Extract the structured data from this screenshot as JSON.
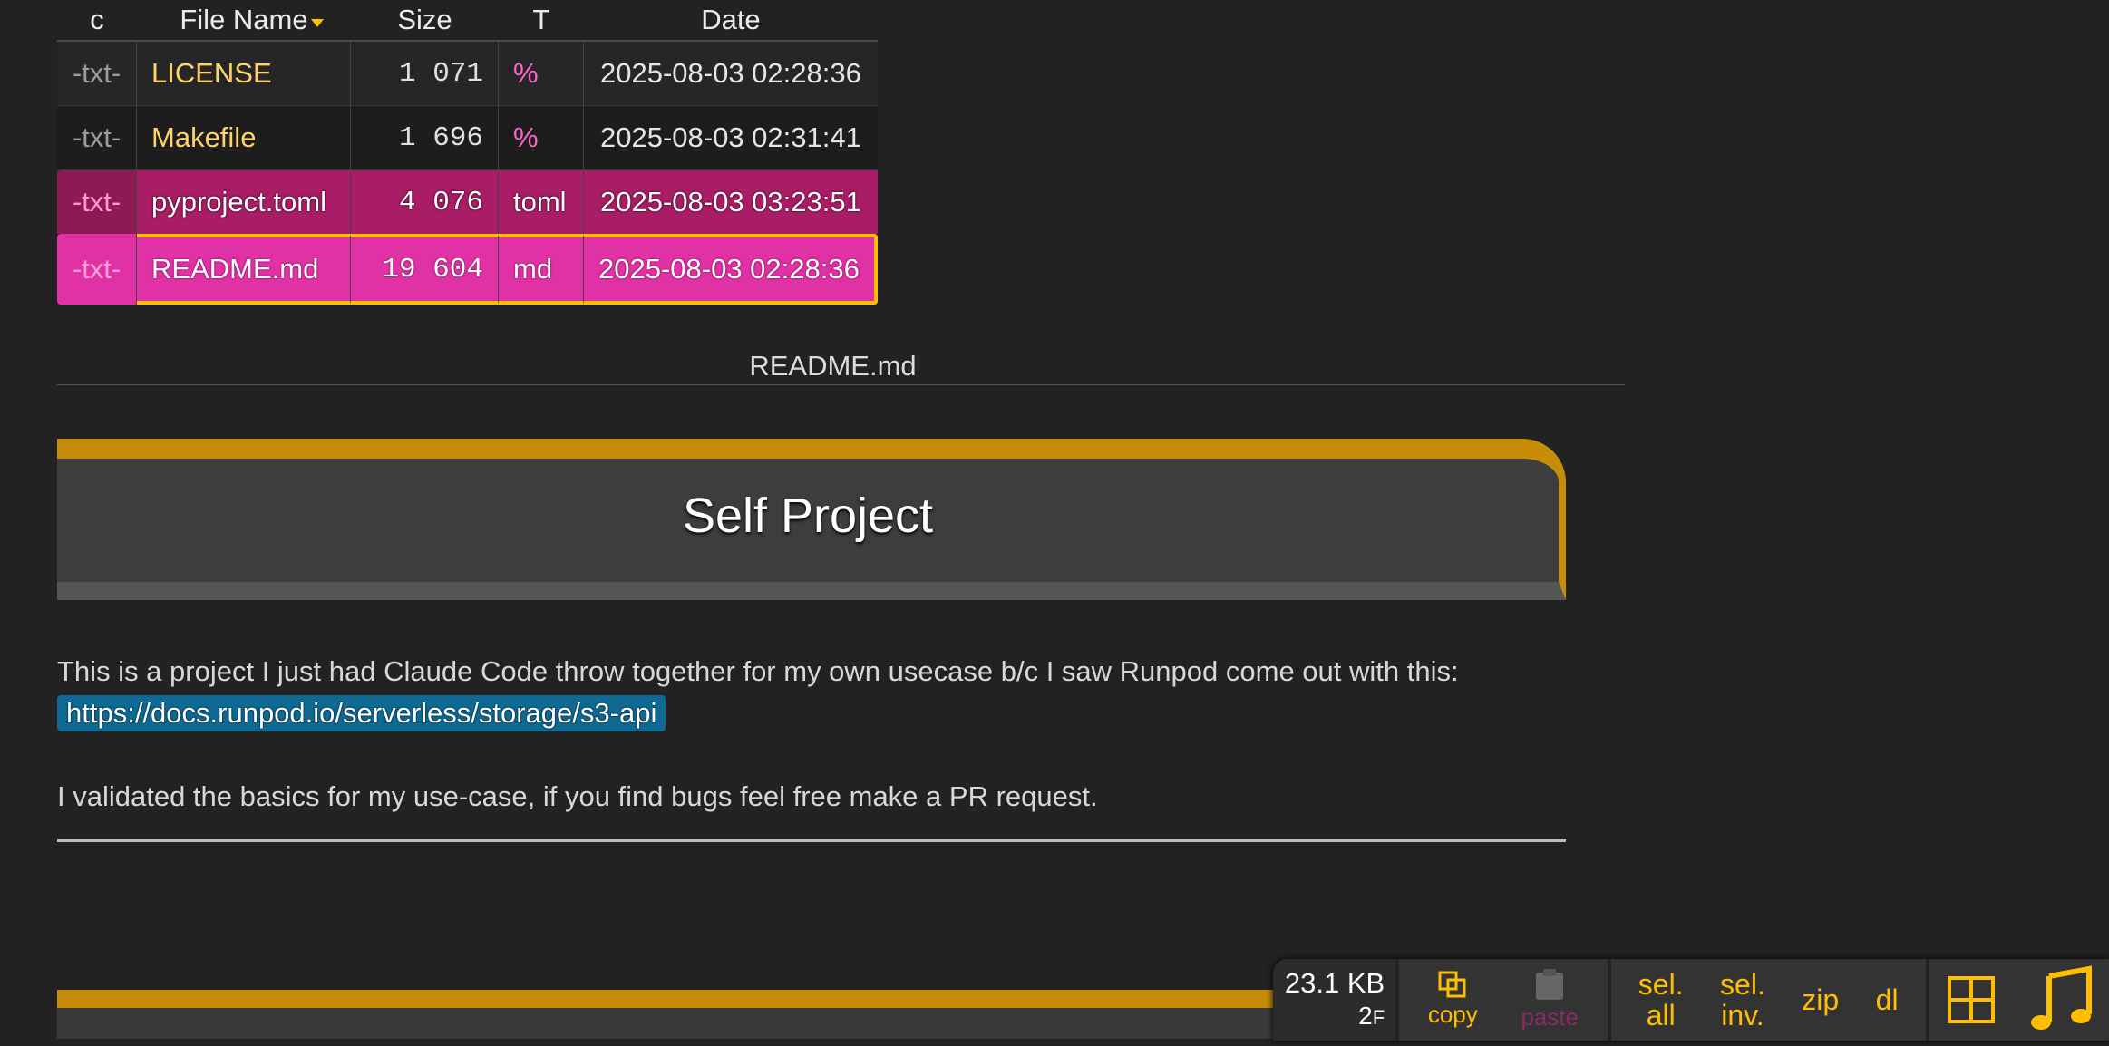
{
  "file_table": {
    "columns": [
      "c",
      "File Name",
      "Size",
      "T",
      "Date"
    ],
    "rows": [
      {
        "c": "-txt-",
        "name": "LICENSE",
        "size": "1 071",
        "type": "%",
        "date": "2025-08-03 02:28:36"
      },
      {
        "c": "-txt-",
        "name": "Makefile",
        "size": "1 696",
        "type": "%",
        "date": "2025-08-03 02:31:41"
      },
      {
        "c": "-txt-",
        "name": "pyproject.toml",
        "size": "4 076",
        "type": "toml",
        "date": "2025-08-03 03:23:51"
      },
      {
        "c": "-txt-",
        "name": "README.md",
        "size": "19 604",
        "type": "md",
        "date": "2025-08-03 02:28:36"
      }
    ]
  },
  "readme": {
    "filename": "README.md",
    "title": "Self Project",
    "paragraph1": "This is a project I just had Claude Code throw together for my own usecase b/c I saw Runpod come out with this:",
    "link": "https://docs.runpod.io/serverless/storage/s3-api",
    "paragraph2": "I validated the basics for my use-case, if you find bugs feel free make a PR request."
  },
  "toolbar": {
    "total_size": "23.1 KB",
    "file_count": "2",
    "file_count_unit": "F",
    "copy_label": "copy",
    "paste_label": "paste",
    "select_all_line1": "sel.",
    "select_all_line2": "all",
    "select_inverse_line1": "sel.",
    "select_inverse_line2": "inv.",
    "zip_label": "zip",
    "download_label": "dl"
  },
  "icons": {
    "copy": "copy-icon",
    "paste": "clipboard-icon",
    "grid": "grid-view-icon",
    "audio": "music-note-icon"
  },
  "colors": {
    "accent": "#ffbf00",
    "selected_row": "#a91c66",
    "cursor_row": "#e032a5",
    "link_bg": "#0e6a94",
    "title_bar": "#c58e06"
  }
}
